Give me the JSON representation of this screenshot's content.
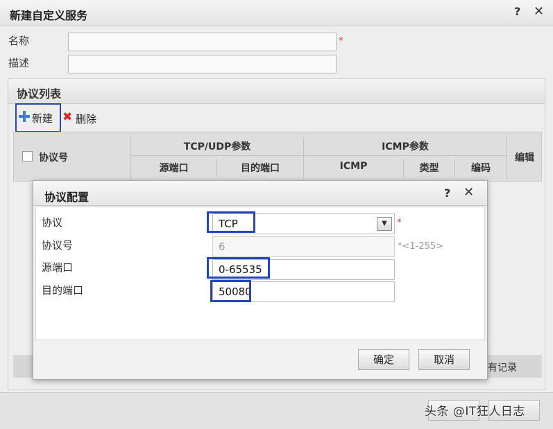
{
  "outer": {
    "title": "新建自定义服务",
    "help_icon": "?",
    "close_icon": "✕",
    "name_label": "名称",
    "name_value": "",
    "desc_label": "描述",
    "desc_value": "",
    "required_mark": "*",
    "protocol_list_title": "协议列表",
    "toolbar": {
      "new_label": "新建",
      "delete_label": "删除"
    },
    "table": {
      "col_protocol_no": "协议号",
      "group_tcp_udp": "TCP/UDP参数",
      "col_src_port": "源端口",
      "col_dst_port": "目的端口",
      "group_icmp": "ICMP参数",
      "col_icmp": "ICMP",
      "col_type": "类型",
      "col_code": "编码",
      "col_edit": "编辑"
    },
    "records_text": "有记录"
  },
  "inner": {
    "title": "协议配置",
    "help_icon": "?",
    "close_icon": "✕",
    "protocol_label": "协议",
    "protocol_value": "TCP",
    "protocol_no_label": "协议号",
    "protocol_no_value": "6",
    "protocol_no_hint": "*<1-255>",
    "src_port_label": "源端口",
    "src_port_value": "0-65535",
    "dst_port_label": "目的端口",
    "dst_port_value": "50080",
    "required_mark": "*",
    "ok_label": "确定",
    "cancel_label": "取消"
  },
  "watermark": "头条 @IT狂人日志",
  "colors": {
    "highlight": "#2347b8",
    "required": "#dd3333",
    "add_icon": "#3b7fd0",
    "delete_icon": "#d42a2a"
  },
  "icons": {
    "add": "plus-icon",
    "delete": "x-icon",
    "dropdown": "chevron-down-icon"
  }
}
